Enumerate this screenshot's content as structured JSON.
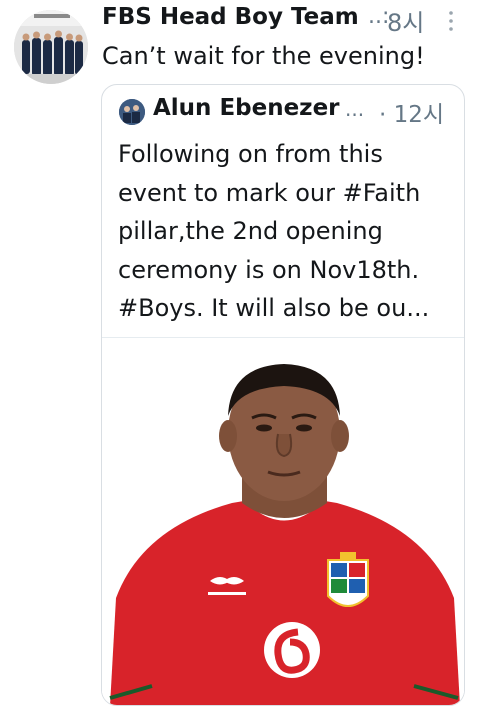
{
  "tweet": {
    "author_name": "FBS Head Boy Team",
    "author_ellipsis": "..:",
    "time": "8시",
    "text": "Can’t wait for the evening!",
    "more_icon": "vertical-dots-icon"
  },
  "quote": {
    "author_name": "Alun Ebenezer",
    "author_ellipsis": "...",
    "time": "· 12시",
    "lines": [
      "Following on from this",
      "event to mark our #Faith",
      "pillar,the 2nd opening",
      "ceremony is on Nov18th.",
      "#Boys. It will also be ou..."
    ],
    "media": {
      "description_icon": "rugby-player-photo",
      "shirt_color": "#d8232a",
      "skin_color": "#8a5a43"
    }
  },
  "colors": {
    "text": "#14171a",
    "secondary": "#657786",
    "border": "#d9dee3"
  }
}
